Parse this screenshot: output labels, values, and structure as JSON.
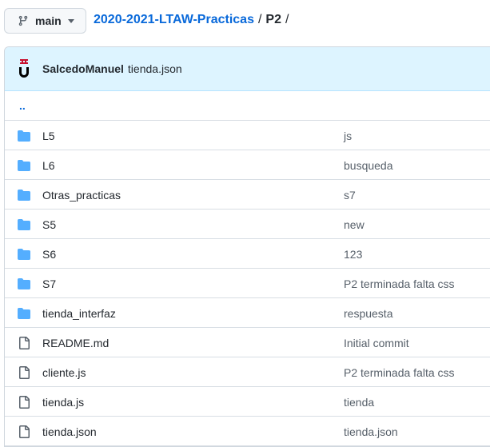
{
  "branch": {
    "name": "main",
    "icon": "git-branch-icon"
  },
  "breadcrumb": {
    "repo": "2020-2021-LTAW-Practicas",
    "separator": "/",
    "current": "P2",
    "trailing": "/"
  },
  "commit": {
    "author": "SalcedoManuel",
    "message": "tienda.json",
    "avatar": "urjc-logo-avatar"
  },
  "updir": {
    "label": ".."
  },
  "files": [
    {
      "type": "dir",
      "name": "L5",
      "message": "js"
    },
    {
      "type": "dir",
      "name": "L6",
      "message": "busqueda"
    },
    {
      "type": "dir",
      "name": "Otras_practicas",
      "message": "s7"
    },
    {
      "type": "dir",
      "name": "S5",
      "message": "new"
    },
    {
      "type": "dir",
      "name": "S6",
      "message": "123"
    },
    {
      "type": "dir",
      "name": "S7",
      "message": "P2 terminada falta css"
    },
    {
      "type": "dir",
      "name": "tienda_interfaz",
      "message": "respuesta"
    },
    {
      "type": "file",
      "name": "README.md",
      "message": "Initial commit"
    },
    {
      "type": "file",
      "name": "cliente.js",
      "message": "P2 terminada falta css"
    },
    {
      "type": "file",
      "name": "tienda.js",
      "message": "tienda"
    },
    {
      "type": "file",
      "name": "tienda.json",
      "message": "tienda.json"
    }
  ],
  "colors": {
    "link": "#0969da",
    "folder": "#54aeff",
    "file": "#57606a",
    "commit_bg": "#ddf4ff",
    "avatar_red": "#c8102e"
  }
}
